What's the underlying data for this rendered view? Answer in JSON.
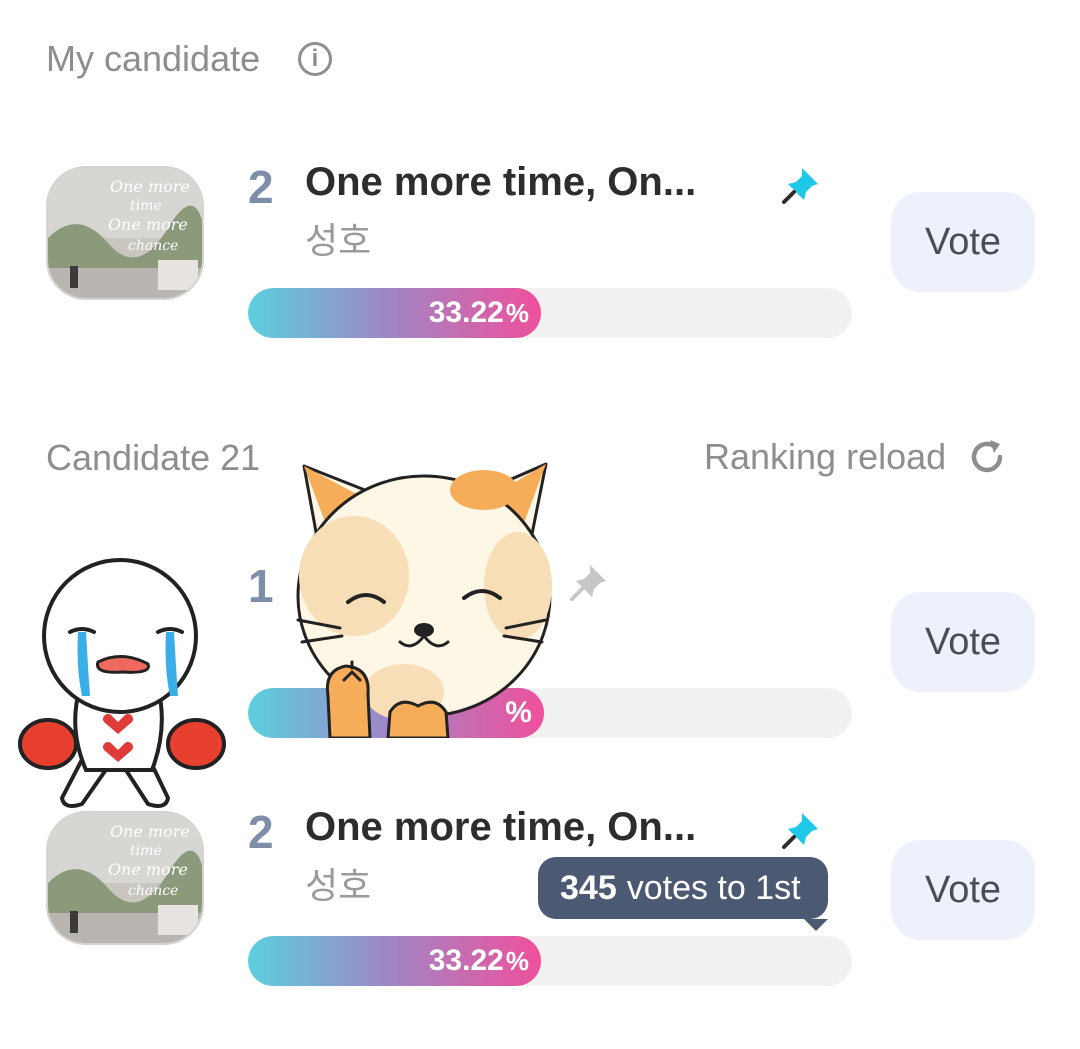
{
  "my_candidate": {
    "title": "My candidate",
    "entry": {
      "rank": "2",
      "title": "One more time, On...",
      "artist": "성호",
      "percent": "33.22",
      "percent_sign": "%",
      "vote_label": "Vote",
      "pinned": true,
      "pin_color": "#1fc8e8"
    }
  },
  "candidates": {
    "title": "Candidate 21",
    "reload_label": "Ranking reload",
    "items": [
      {
        "rank": "1",
        "percent": "",
        "percent_tail": "%",
        "vote_label": "Vote",
        "pinned": false,
        "pin_color": "#c7c7c7"
      },
      {
        "rank": "2",
        "title": "One more time, On...",
        "artist": "성호",
        "percent": "33.22",
        "percent_sign": "%",
        "vote_label": "Vote",
        "pinned": true,
        "pin_color": "#1fc8e8",
        "tooltip": {
          "count": "345",
          "text": "votes to 1st"
        }
      }
    ]
  },
  "colors": {
    "bar_gradient_start": "#5ccfe0",
    "bar_gradient_end": "#f0509c",
    "vote_button_bg": "#ecf1fb",
    "tooltip_bg": "#4b5a72"
  },
  "icons": [
    "info-icon",
    "pin-icon",
    "reload-icon",
    "album-cover",
    "crying-character-sticker",
    "angry-cat-sticker"
  ]
}
